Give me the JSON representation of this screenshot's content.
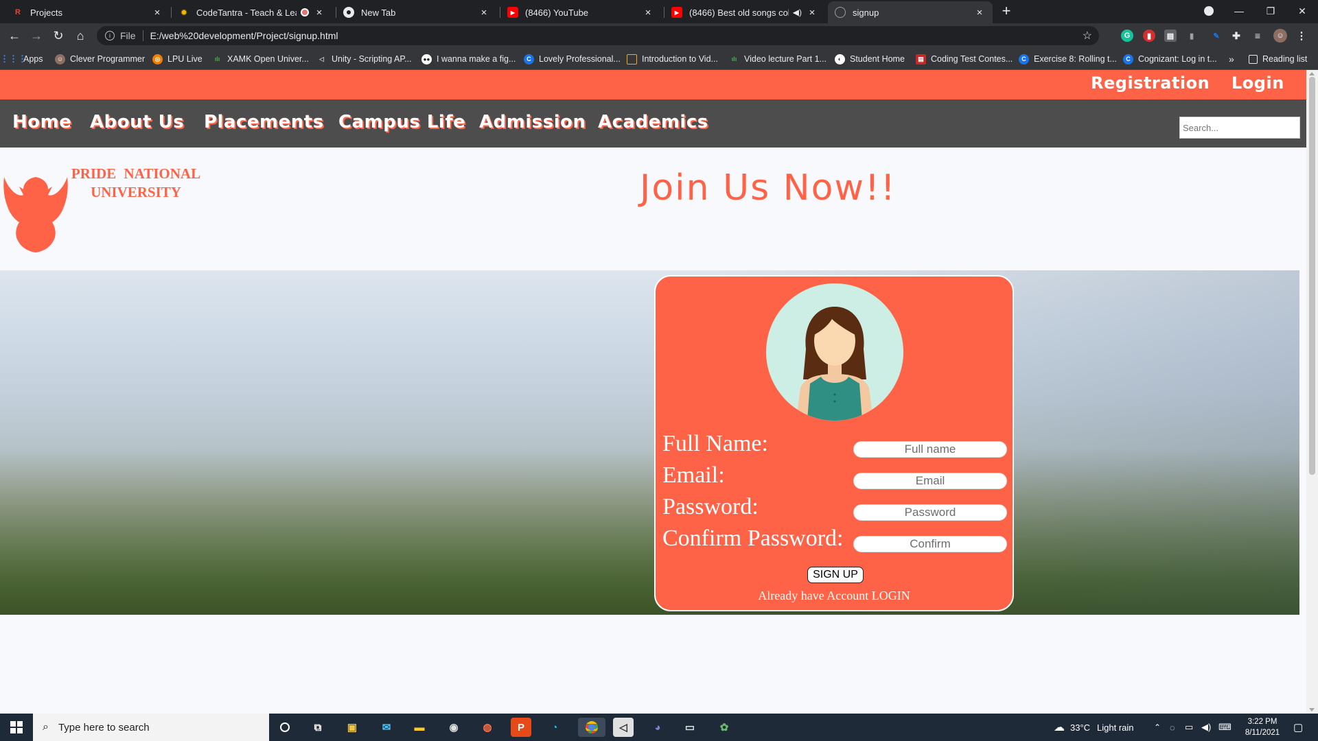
{
  "browser": {
    "tabs": [
      {
        "title": "Projects",
        "icon": "r-icon"
      },
      {
        "title": "CodeTantra - Teach & Learn",
        "icon": "gear-icon"
      },
      {
        "title": "New Tab",
        "icon": "chrome-icon"
      },
      {
        "title": "(8466) YouTube",
        "icon": "youtube-icon"
      },
      {
        "title": "(8466) Best old songs collect",
        "icon": "youtube-icon"
      },
      {
        "title": "signup",
        "icon": "globe-icon"
      }
    ],
    "address": {
      "scheme": "File",
      "url": "E:/web%20development/Project/signup.html"
    },
    "bookmarks": [
      "Apps",
      "Clever Programmer",
      "LPU Live",
      "XAMK Open Univer...",
      "Unity - Scripting AP...",
      "I wanna make a fig...",
      "Lovely Professional...",
      "Introduction to Vid...",
      "Video lecture Part 1...",
      "Student Home",
      "Coding Test Contes...",
      "Exercise 8: Rolling t...",
      "Cognizant: Log in t..."
    ],
    "more_bookmarks": "»",
    "reading_list": "Reading list"
  },
  "page": {
    "topbar": {
      "registration": "Registration",
      "login": "Login"
    },
    "nav": [
      "Home",
      "About Us",
      "Placements",
      "Campus Life",
      "Admission",
      "Academics"
    ],
    "search_placeholder": "Search...",
    "brand": {
      "line1": "PRIDE  NATIONAL",
      "line2": "UNIVERSITY"
    },
    "headline": "Join Us Now!!",
    "form": {
      "labels": [
        "Full Name:",
        "Email:",
        "Password:",
        "Confirm Password:"
      ],
      "placeholders": [
        "Full name",
        "Email",
        "Password",
        "Confirm"
      ],
      "signup_button": "SIGN UP",
      "login_prefix": "Already have Account ",
      "login_link": "LOGIN"
    }
  },
  "taskbar": {
    "search_placeholder": "Type here to search",
    "weather": {
      "temp": "33°C",
      "condition": "Light rain"
    },
    "time": "3:22 PM",
    "date": "8/11/2021"
  },
  "colors": {
    "accent": "#ff6347",
    "navbar": "#4d4d4d"
  }
}
